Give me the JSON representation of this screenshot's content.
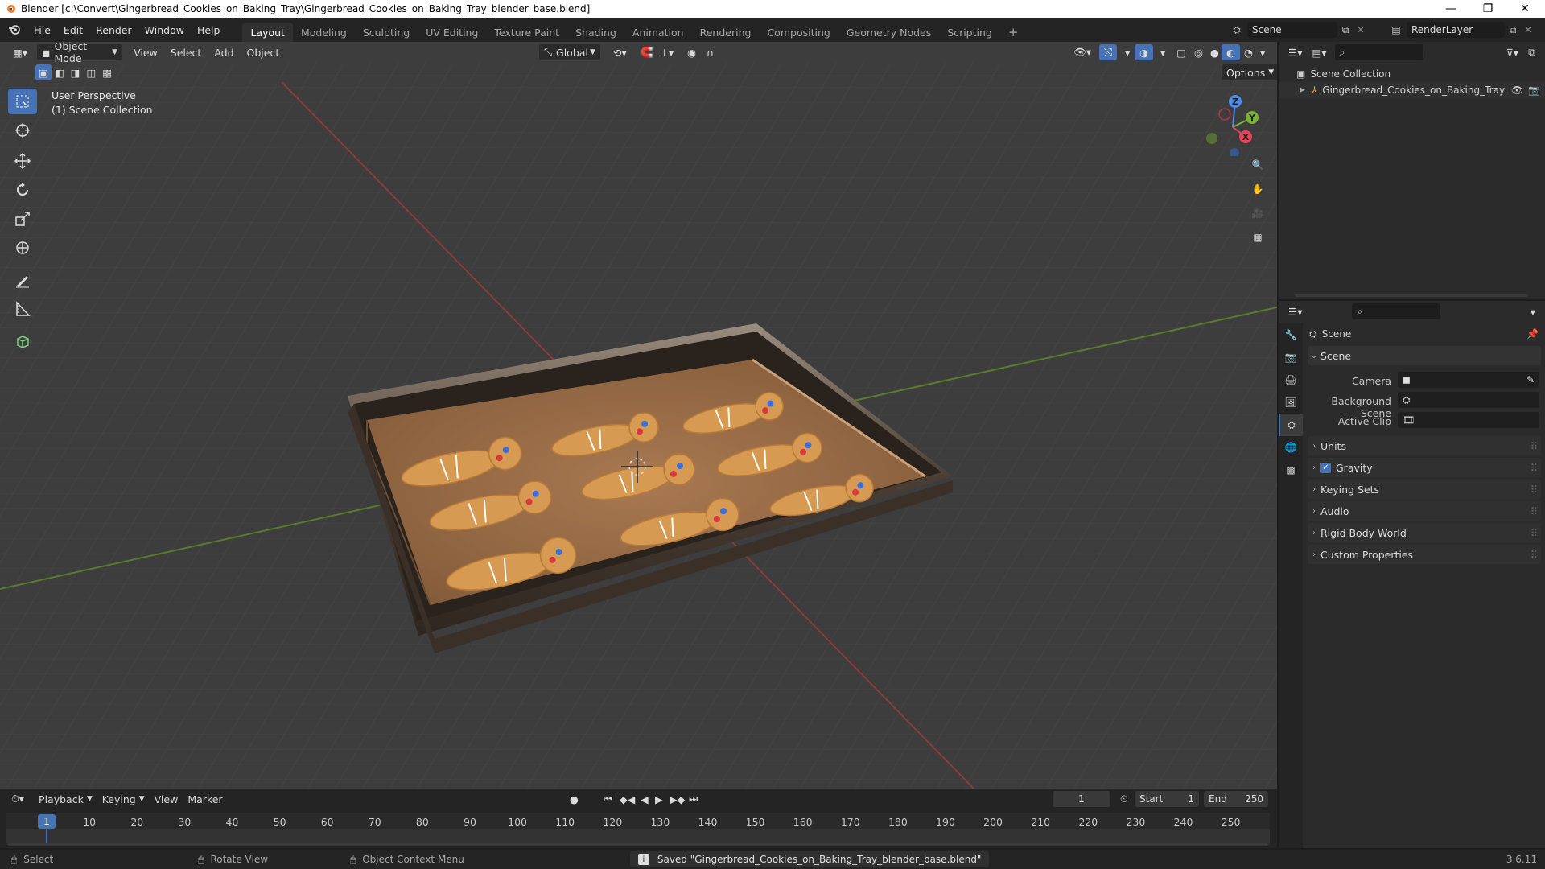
{
  "window": {
    "title": "Blender [c:\\Convert\\Gingerbread_Cookies_on_Baking_Tray\\Gingerbread_Cookies_on_Baking_Tray_blender_base.blend]"
  },
  "menu": [
    "File",
    "Edit",
    "Render",
    "Window",
    "Help"
  ],
  "workspaces": [
    "Layout",
    "Modeling",
    "Sculpting",
    "UV Editing",
    "Texture Paint",
    "Shading",
    "Animation",
    "Rendering",
    "Compositing",
    "Geometry Nodes",
    "Scripting"
  ],
  "workspace_active": "Layout",
  "top_right": {
    "scene": "Scene",
    "view_layer": "RenderLayer"
  },
  "viewport": {
    "mode": "Object Mode",
    "menus": [
      "View",
      "Select",
      "Add",
      "Object"
    ],
    "orientation": "Global",
    "options_label": "Options",
    "overlay_line1": "User Perspective",
    "overlay_line2": "(1) Scene Collection",
    "gizmo": {
      "x": "X",
      "y": "Y",
      "z": "Z"
    }
  },
  "outliner": {
    "root": "Scene Collection",
    "items": [
      "Gingerbread_Cookies_on_Baking_Tray"
    ]
  },
  "properties": {
    "header": "Scene",
    "panel": "Scene",
    "fields": {
      "camera": "Camera",
      "background_scene": "Background Scene",
      "active_clip": "Active Clip"
    },
    "subpanels": [
      "Units",
      "Gravity",
      "Keying Sets",
      "Audio",
      "Rigid Body World",
      "Custom Properties"
    ]
  },
  "timeline": {
    "menus": [
      "Playback",
      "Keying",
      "View",
      "Marker"
    ],
    "current_frame": "1",
    "start_label": "Start",
    "start": "1",
    "end_label": "End",
    "end": "250",
    "playhead": "1",
    "ticks": [
      "10",
      "20",
      "30",
      "40",
      "50",
      "60",
      "70",
      "80",
      "90",
      "100",
      "110",
      "120",
      "130",
      "140",
      "150",
      "160",
      "170",
      "180",
      "190",
      "200",
      "210",
      "220",
      "230",
      "240",
      "250"
    ]
  },
  "status": {
    "select": "Select",
    "rotate": "Rotate View",
    "context": "Object Context Menu",
    "message": "Saved \"Gingerbread_Cookies_on_Baking_Tray_blender_base.blend\"",
    "version": "3.6.11"
  },
  "colors": {
    "accent": "#4772b3",
    "x_axis": "#e84356",
    "y_axis": "#7ab23b",
    "z_axis": "#4e8ee8",
    "viewport_bg": "#3d3d3d"
  }
}
